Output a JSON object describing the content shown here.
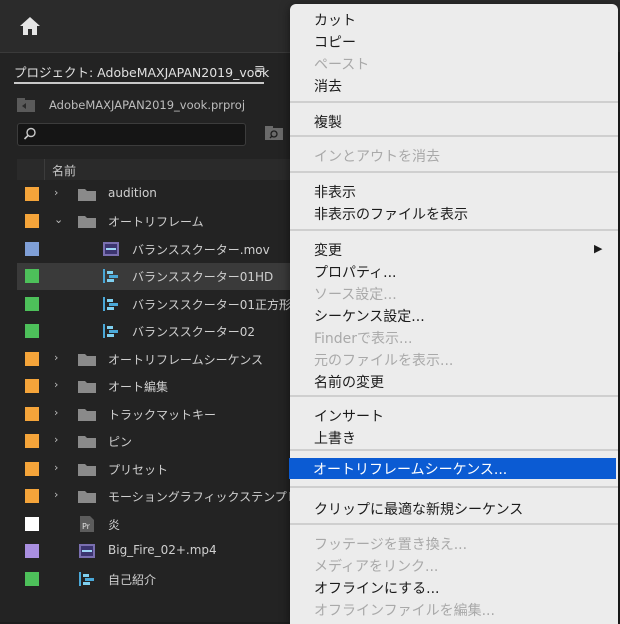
{
  "header": {
    "home_icon": "home-icon"
  },
  "project": {
    "tab_title": "プロジェクト: AdobeMAXJAPAN2019_vook",
    "menu_glyph": "≡",
    "file_name": "AdobeMAXJAPAN2019_vook.prproj",
    "search_value": "",
    "column_name": "名前"
  },
  "items": [
    {
      "label": "audition",
      "type": "folder",
      "color": "#f4a43a",
      "expand": "collapsed",
      "indent": 0
    },
    {
      "label": "オートリフレーム",
      "type": "folder",
      "color": "#f4a43a",
      "expand": "expanded",
      "indent": 0
    },
    {
      "label": "バランススクーター.mov",
      "type": "video-clip",
      "color": "#7f9fd6",
      "expand": "none",
      "indent": 1
    },
    {
      "label": "バランススクーター01HD",
      "type": "sequence",
      "color": "#4dc05a",
      "expand": "none",
      "indent": 1,
      "selected": true
    },
    {
      "label": "バランススクーター01正方形",
      "type": "sequence",
      "color": "#4dc05a",
      "expand": "none",
      "indent": 1
    },
    {
      "label": "バランススクーター02",
      "type": "sequence",
      "color": "#4dc05a",
      "expand": "none",
      "indent": 1
    },
    {
      "label": "オートリフレームシーケンス",
      "type": "folder",
      "color": "#f4a43a",
      "expand": "collapsed",
      "indent": 0
    },
    {
      "label": "オート編集",
      "type": "folder",
      "color": "#f4a43a",
      "expand": "collapsed",
      "indent": 0
    },
    {
      "label": "トラックマットキー",
      "type": "folder",
      "color": "#f4a43a",
      "expand": "collapsed",
      "indent": 0
    },
    {
      "label": "ピン",
      "type": "folder",
      "color": "#f4a43a",
      "expand": "collapsed",
      "indent": 0
    },
    {
      "label": "プリセット",
      "type": "folder",
      "color": "#f4a43a",
      "expand": "collapsed",
      "indent": 0
    },
    {
      "label": "モーショングラフィックステンプレート",
      "type": "folder",
      "color": "#f4a43a",
      "expand": "collapsed",
      "indent": 0
    },
    {
      "label": "炎",
      "type": "premiere-project",
      "color": "#ffffff",
      "expand": "none",
      "indent": 0
    },
    {
      "label": "Big_Fire_02+.mp4",
      "type": "video-clip",
      "color": "#a98fe0",
      "expand": "none",
      "indent": 0
    },
    {
      "label": "自己紹介",
      "type": "sequence",
      "color": "#4dc05a",
      "expand": "none",
      "indent": 0
    }
  ],
  "context_menu": {
    "items": [
      {
        "label": "カット",
        "disabled": false
      },
      {
        "label": "コピー",
        "disabled": false
      },
      {
        "label": "ペースト",
        "disabled": true
      },
      {
        "label": "消去",
        "disabled": false
      },
      {
        "label": "複製",
        "disabled": false
      },
      {
        "label": "インとアウトを消去",
        "disabled": true
      },
      {
        "label": "非表示",
        "disabled": false
      },
      {
        "label": "非表示のファイルを表示",
        "disabled": false
      },
      {
        "label": "変更",
        "disabled": false,
        "submenu": true
      },
      {
        "label": "プロパティ...",
        "disabled": false
      },
      {
        "label": "ソース設定...",
        "disabled": true
      },
      {
        "label": "シーケンス設定...",
        "disabled": false
      },
      {
        "label": "Finderで表示...",
        "disabled": true
      },
      {
        "label": "元のファイルを表示...",
        "disabled": true
      },
      {
        "label": "名前の変更",
        "disabled": false
      },
      {
        "label": "インサート",
        "disabled": false
      },
      {
        "label": "上書き",
        "disabled": false
      },
      {
        "label": "オートリフレームシーケンス...",
        "disabled": false,
        "highlighted": true
      },
      {
        "label": "クリップに最適な新規シーケンス",
        "disabled": false
      },
      {
        "label": "フッテージを置き換え...",
        "disabled": true
      },
      {
        "label": "メディアをリンク...",
        "disabled": true
      },
      {
        "label": "オフラインにする...",
        "disabled": false
      },
      {
        "label": "オフラインファイルを編集...",
        "disabled": true
      }
    ],
    "submenu_arrow": "▶",
    "highlight_color": "#0b5bd3"
  }
}
